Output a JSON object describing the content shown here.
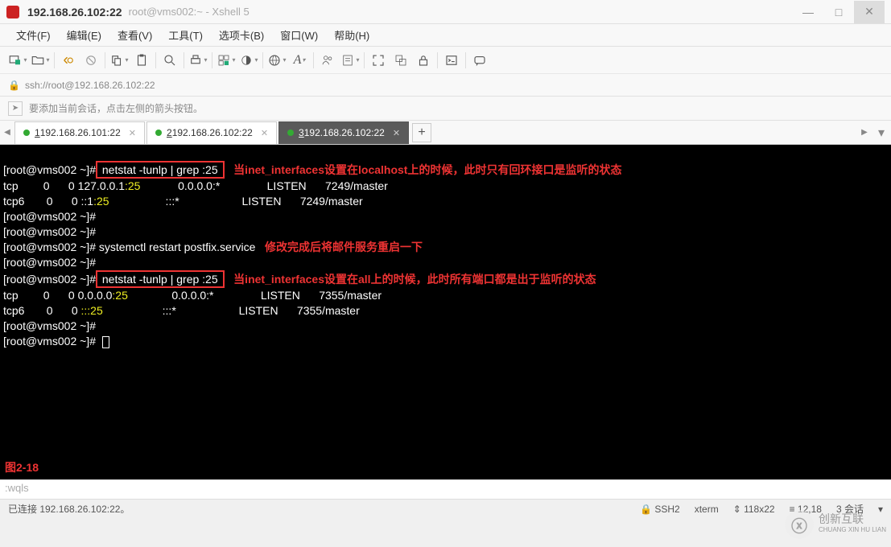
{
  "titlebar": {
    "main": "192.168.26.102:22",
    "sub": "root@vms002:~ - Xshell 5"
  },
  "menubar": {
    "file": "文件(F)",
    "edit": "编辑(E)",
    "view": "查看(V)",
    "tools": "工具(T)",
    "tab": "选项卡(B)",
    "window": "窗口(W)",
    "help": "帮助(H)"
  },
  "addressbar": {
    "url": "ssh://root@192.168.26.102:22"
  },
  "hintbar": {
    "text": "要添加当前会话，点击左侧的箭头按钮。"
  },
  "tabs": {
    "t1": {
      "num": "1",
      "label": " 192.168.26.101:22"
    },
    "t2": {
      "num": "2",
      "label": " 192.168.26.102:22"
    },
    "t3": {
      "num": "3",
      "label": " 192.168.26.102:22"
    }
  },
  "terminal": {
    "prompt": "[root@vms002 ~]#",
    "cmd1": " netstat -tunlp | grep :25 ",
    "note1": "   当inet_interfaces设置在localhost上的时候，此时只有回环接口是监听的状态",
    "l1a": "tcp        0",
    "l1b": "      0 127.0.0.1",
    "l1c": ":25",
    "l1d": "            0.0.0.0:*               LISTEN      7249/master",
    "l2a": "tcp6       0",
    "l2b": "      0 ::1",
    "l2c": ":25",
    "l2d": "                  :::*                    LISTEN      7249/master",
    "cmd2": " systemctl restart postfix.service",
    "note2": "   修改完成后将邮件服务重启一下",
    "cmd3": " netstat -tunlp | grep :25 ",
    "note3": "   当inet_interfaces设置在all上的时候，此时所有端口都是出于监听的状态",
    "l3a": "tcp        0",
    "l3b": "      0 0.0.0.0",
    "l3c": ":25",
    "l3d": "              0.0.0.0:*               LISTEN      7355/master",
    "l4a": "tcp6       0",
    "l4b": "      0 ",
    "l4c": ":::25",
    "l4d": "                   :::*                    LISTEN      7355/master",
    "caption": "图2-18"
  },
  "inputbar": {
    "text": ":wqls"
  },
  "statusbar": {
    "left": "已连接 192.168.26.102:22。",
    "ssh": "SSH2",
    "term": "xterm",
    "size": "118x22",
    "pos": "12,18",
    "sess": "3 会话"
  },
  "watermark": {
    "brand": "创新互联",
    "sub": "CHUANG XIN HU LIAN"
  }
}
